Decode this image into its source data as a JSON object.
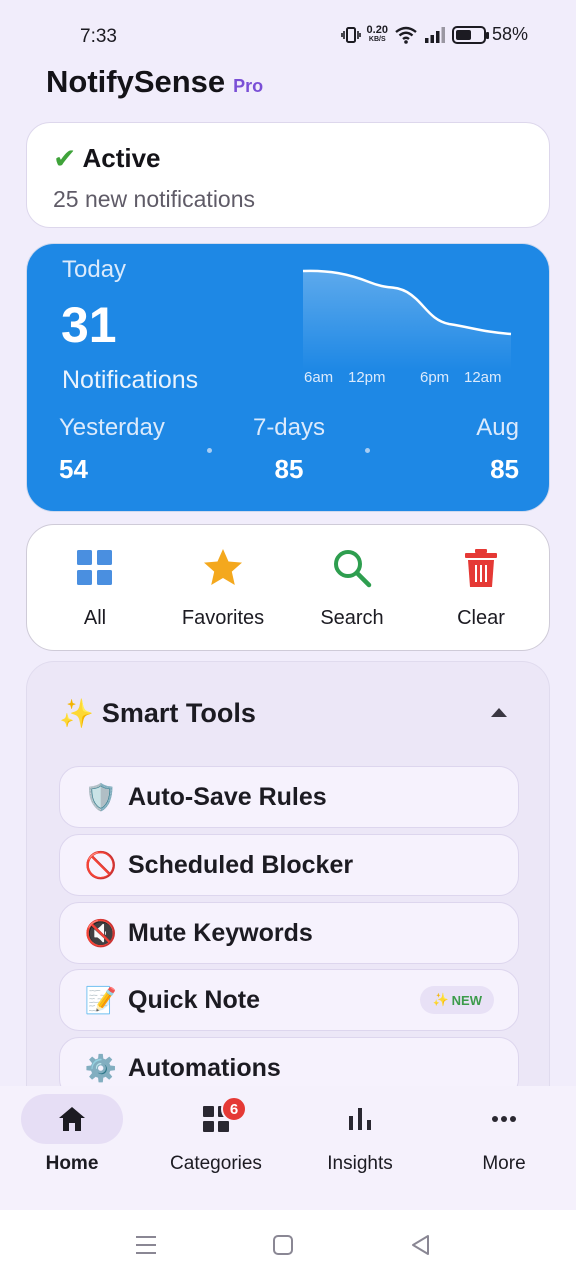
{
  "status_bar": {
    "time": "7:33",
    "net_speed": "0.20",
    "net_unit": "KB/S",
    "battery": "58%",
    "battery_level": 0.58
  },
  "header": {
    "title": "NotifySense",
    "badge": "Pro"
  },
  "status_card": {
    "label": "Active",
    "subtitle": "25 new notifications"
  },
  "stats": {
    "today_label": "Today",
    "today_count": "31",
    "today_unit": "Notifications",
    "time_labels": [
      "6am",
      "12pm",
      "6pm",
      "12am"
    ],
    "compare": [
      {
        "label": "Yesterday",
        "value": "54"
      },
      {
        "label": "7-days",
        "value": "85"
      },
      {
        "label": "Aug",
        "value": "85"
      }
    ]
  },
  "actions": [
    {
      "label": "All",
      "icon": "grid-icon"
    },
    {
      "label": "Favorites",
      "icon": "star-icon"
    },
    {
      "label": "Search",
      "icon": "search-icon"
    },
    {
      "label": "Clear",
      "icon": "trash-icon"
    }
  ],
  "smart_tools": {
    "emoji": "✨",
    "title": "Smart Tools",
    "items": [
      {
        "emoji": "🛡️",
        "label": "Auto-Save Rules"
      },
      {
        "emoji": "🚫",
        "label": "Scheduled Blocker"
      },
      {
        "emoji": "🔇",
        "label": "Mute Keywords"
      },
      {
        "emoji": "📝",
        "label": "Quick Note",
        "badge": "NEW"
      },
      {
        "emoji": "⚙️",
        "label": "Automations"
      }
    ]
  },
  "bottom_nav": [
    {
      "label": "Home",
      "active": true
    },
    {
      "label": "Categories",
      "badge": "6"
    },
    {
      "label": "Insights"
    },
    {
      "label": "More"
    }
  ],
  "colors": {
    "accent": "#1e88e5",
    "brand": "#7a4fd6",
    "danger": "#e53935",
    "success": "#3fa33a"
  }
}
